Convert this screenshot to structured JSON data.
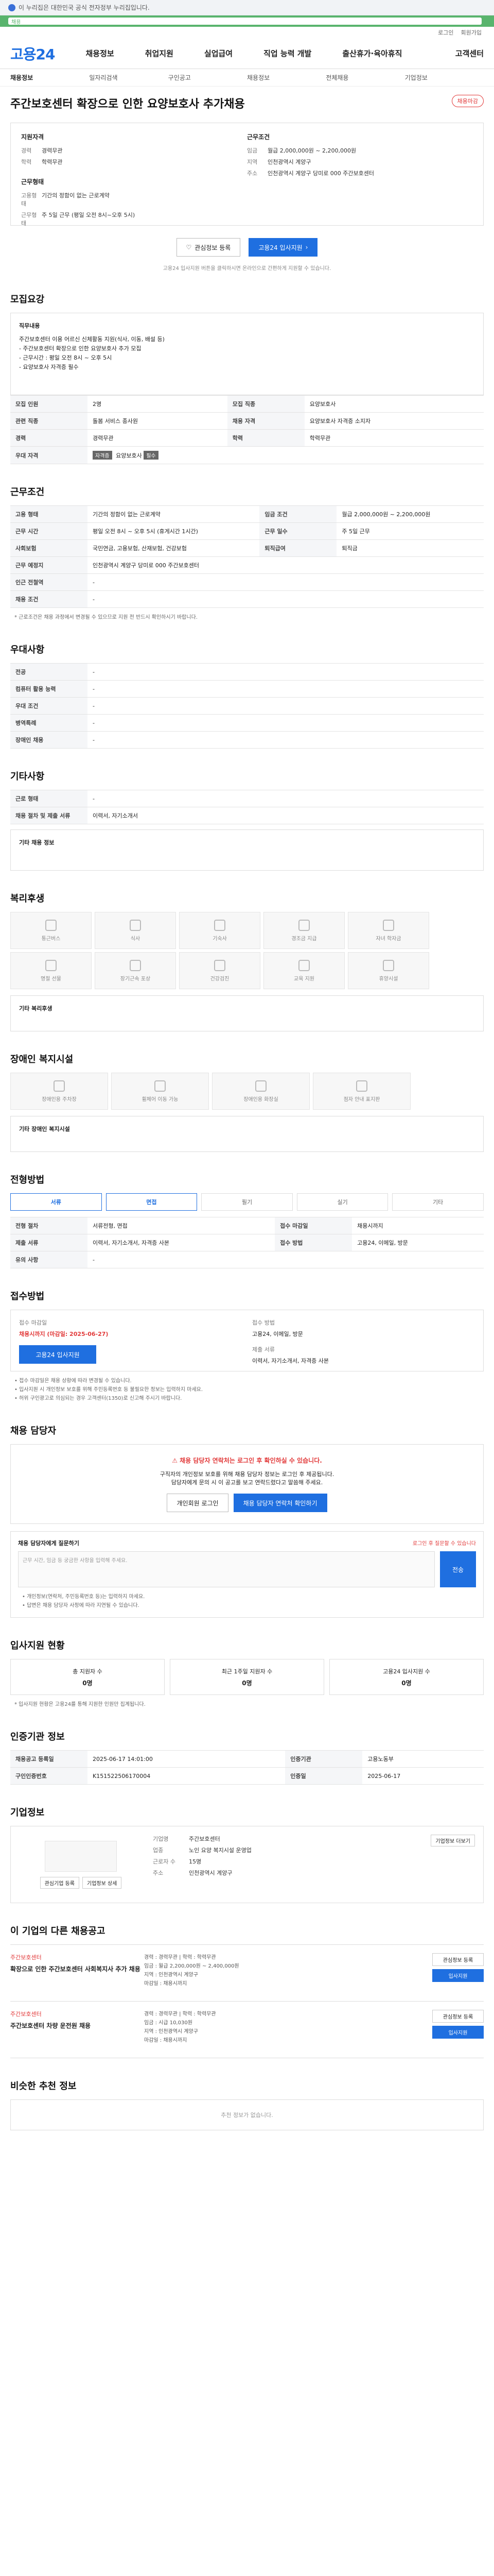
{
  "notice_bar": {
    "text": "이 누리집은 대한민국 공식 전자정부 누리집입니다."
  },
  "green_bar": {
    "text": "채용"
  },
  "topmenu": {
    "items": [
      "로그인",
      "회원가입"
    ]
  },
  "header": {
    "logo": "고용24",
    "nav": [
      "채용정보",
      "취업지원",
      "실업급여",
      "직업 능력 개발",
      "출산휴가·육아휴직"
    ],
    "right": "고객센터"
  },
  "subnav": [
    "채용정보",
    "일자리검색",
    "구인공고",
    "채용정보",
    "전체채용",
    "기업정보"
  ],
  "job": {
    "title": "주간보호센터 확장으로 인한 요양보호사 추가채용",
    "badge": "채용마감",
    "left_head": "지원자격",
    "left_rows": [
      {
        "k": "경력",
        "v": "경력무관"
      },
      {
        "k": "학력",
        "v": "학력무관"
      }
    ],
    "left_head2": "근무형태",
    "left_rows2": [
      {
        "k": "고용형태",
        "v": "기간의 정함이 없는 근로계약"
      },
      {
        "k": "근무형태",
        "v": "주 5일 근무 (평일 오전 8시~오후 5시)"
      }
    ],
    "right_head": "근무조건",
    "right_rows": [
      {
        "k": "임금",
        "v": "월급 2,000,000원 ~ 2,200,000원"
      },
      {
        "k": "지역",
        "v": "인천광역시 계양구"
      },
      {
        "k": "주소",
        "v": "인천광역시 계양구 당미로 000 주간보호센터"
      }
    ],
    "btn_save": "관심정보 등록",
    "btn_apply": "고용24 입사지원",
    "sub_note": "고용24 입사지원 버튼을 클릭하시면 온라인으로 간편하게 지원할 수 있습니다."
  },
  "sections": {
    "recruit": "모집요강",
    "condition": "근무조건",
    "welfare": "복리후생",
    "disabled": "장애인 복지시설",
    "prefer": "우대사항",
    "etc": "기타사항",
    "selection": "전형방법",
    "how": "접수방법",
    "contact": "채용 담당자",
    "stat": "입사지원 현황",
    "info": "인증기관 정보",
    "company": "기업정보",
    "related": "이 기업의 다른 채용공고",
    "recommend": "비슷한 추천 정보"
  },
  "recruit": {
    "desc_head": "직무내용",
    "desc_lines": [
      "주간보호센터 이용 어르신 신체활동 지원(식사, 이동, 배설 등)",
      "- 주간보호센터 확장으로 인한 요양보호사 추가 모집",
      "- 근무시간 : 평일 오전 8시 ~ 오후 5시",
      "- 요양보호사 자격증 필수"
    ],
    "rows": [
      {
        "k": "모집 인원",
        "v": "2명"
      },
      {
        "k": "모집 직종",
        "v": "요양보호사"
      },
      {
        "k": "관련 직종",
        "v": "돌봄 서비스 종사원"
      },
      {
        "k": "채용 자격",
        "v": "요양보호사 자격증 소지자"
      },
      {
        "k": "경력",
        "v": "경력무관"
      },
      {
        "k": "학력",
        "v": "학력무관"
      }
    ],
    "cert_label": "우대 자격",
    "cert_tags": [
      "자격증",
      "요양보호사",
      "필수"
    ]
  },
  "condition_rows": [
    {
      "k": "고용 형태",
      "v": "기간의 정함이 없는 근로계약"
    },
    {
      "k": "임금 조건",
      "v": "월급 2,000,000원 ~ 2,200,000원"
    },
    {
      "k": "근무 시간",
      "v": "평일 오전 8시 ~ 오후 5시 (휴게시간 1시간)"
    },
    {
      "k": "근무 일수",
      "v": "주 5일 근무"
    },
    {
      "k": "사회보험",
      "v": "국민연금, 고용보험, 산재보험, 건강보험"
    },
    {
      "k": "퇴직급여",
      "v": "퇴직금"
    },
    {
      "k": "근무 예정지",
      "v": "인천광역시 계양구 당미로 000 주간보호센터"
    },
    {
      "k": "인근 전철역",
      "v": "-"
    },
    {
      "k": "채용 조건",
      "v": "-"
    }
  ],
  "condition_note": "* 근로조건은 채용 과정에서 변경될 수 있으므로 지원 전 반드시 확인하시기 바랍니다.",
  "prefer_rows": [
    {
      "k": "전공",
      "v": "-"
    },
    {
      "k": "컴퓨터 활용 능력",
      "v": "-"
    },
    {
      "k": "우대 조건",
      "v": "-"
    },
    {
      "k": "병역특례",
      "v": "-"
    },
    {
      "k": "장애인 채용",
      "v": "-"
    }
  ],
  "etc_rows": [
    {
      "k": "근로 형태",
      "v": "-"
    },
    {
      "k": "채용 절차 및 제출 서류",
      "v": "이력서, 자기소개서"
    }
  ],
  "etc_extra_label": "기타 채용 정보",
  "welfare_tiles": [
    "통근버스",
    "식사",
    "기숙사",
    "경조금 지급",
    "자녀 학자금",
    "명절 선물",
    "장기근속 포상",
    "건강검진",
    "교육 지원",
    "휴양시설"
  ],
  "welfare_extra_label": "기타 복리후생",
  "disabled_tiles": [
    "장애인용 주차장",
    "휠체어 이동 가능",
    "장애인용 화장실",
    "점자 안내 표지판"
  ],
  "disabled_extra_label": "기타 장애인 복지시설",
  "selection_rows": [
    {
      "k": "전형 절차",
      "v": "서류전형, 면접"
    },
    {
      "k": "접수 마감일",
      "v": "채용시까지"
    },
    {
      "k": "제출 서류",
      "v": "이력서, 자기소개서, 자격증 사본"
    },
    {
      "k": "접수 방법",
      "v": "고용24, 이메일, 방문"
    },
    {
      "k": "유의 사항",
      "v": "-"
    }
  ],
  "selection_methods": [
    "서류",
    "면접",
    "필기",
    "실기",
    "기타"
  ],
  "how": {
    "deadline_label": "접수 마감일",
    "deadline_value": "채용시까지 (마감일: 2025-06-27)",
    "apply_btn": "고용24 입사지원",
    "method_label": "접수 방법",
    "method_value": "고용24, 이메일, 방문",
    "doc_label": "제출 서류",
    "doc_value": "이력서, 자기소개서, 자격증 사본",
    "bullets": [
      "• 접수 마감일은 채용 상황에 따라 변경될 수 있습니다.",
      "• 입사지원 시 개인정보 보호를 위해 주민등록번호 등 불필요한 정보는 입력하지 마세요.",
      "• 허위 구인광고로 의심되는 경우 고객센터(1350)로 신고해 주시기 바랍니다."
    ]
  },
  "contact": {
    "warn": "채용 담당자 연락처는 로그인 후 확인하실 수 있습니다.",
    "line1": "구직자의 개인정보 보호를 위해 채용 담당자 정보는 로그인 후 제공됩니다.",
    "line2": "담당자에게 문의 시 이 공고를 보고 연락드렸다고 말씀해 주세요.",
    "btn1": "개인회원 로그인",
    "btn2": "채용 담당자 연락처 확인하기",
    "qa_title": "채용 담당자에게 질문하기",
    "qa_hint": "로그인 후 질문할 수 있습니다",
    "qa_placeholder": "근무 시간, 임금 등 궁금한 사항을 입력해 주세요.",
    "qa_send": "전송",
    "qa_notes": [
      "• 개인정보(연락처, 주민등록번호 등)는 입력하지 마세요.",
      "• 답변은 채용 담당자 사정에 따라 지연될 수 있습니다."
    ]
  },
  "stat": {
    "items": [
      {
        "label": "총 지원자 수",
        "n": "0명"
      },
      {
        "label": "최근 1주일 지원자 수",
        "n": "0명"
      },
      {
        "label": "고용24 입사지원 수",
        "n": "0명"
      }
    ],
    "note": "* 입사지원 현황은 고용24를 통해 지원한 인원만 집계됩니다."
  },
  "info_rows": [
    {
      "k": "채용공고 등록일",
      "v": "2025-06-17 14:01:00"
    },
    {
      "k": "인증기관",
      "v": "고용노동부"
    },
    {
      "k": "구인인증번호",
      "v": "K151522506170004"
    },
    {
      "k": "인증일",
      "v": "2025-06-17"
    }
  ],
  "company": {
    "btn1": "관심기업 등록",
    "btn2": "기업정보 상세",
    "rows": [
      {
        "k": "기업명",
        "v": "주간보호센터"
      },
      {
        "k": "업종",
        "v": "노인 요양 복지시설 운영업"
      },
      {
        "k": "근로자 수",
        "v": "15명"
      },
      {
        "k": "주소",
        "v": "인천광역시 계양구"
      }
    ],
    "detail_btn": "기업정보 더보기"
  },
  "related": [
    {
      "co": "주간보호센터",
      "title": "확장으로 인한 주간보호센터 사회복지사 추가 채용",
      "lines": [
        "경력 : 경력무관 | 학력 : 학력무관",
        "임금 : 월급 2,200,000원 ~ 2,400,000원",
        "지역 : 인천광역시 계양구",
        "마감일 : 채용시까지"
      ],
      "btn1": "관심정보 등록",
      "btn2": "입사지원"
    },
    {
      "co": "주간보호센터",
      "title": "주간보호센터 차량 운전원 채용",
      "lines": [
        "경력 : 경력무관 | 학력 : 학력무관",
        "임금 : 시급 10,030원",
        "지역 : 인천광역시 계양구",
        "마감일 : 채용시까지"
      ],
      "btn1": "관심정보 등록",
      "btn2": "입사지원"
    }
  ],
  "recommend_empty": "추천 정보가 없습니다."
}
